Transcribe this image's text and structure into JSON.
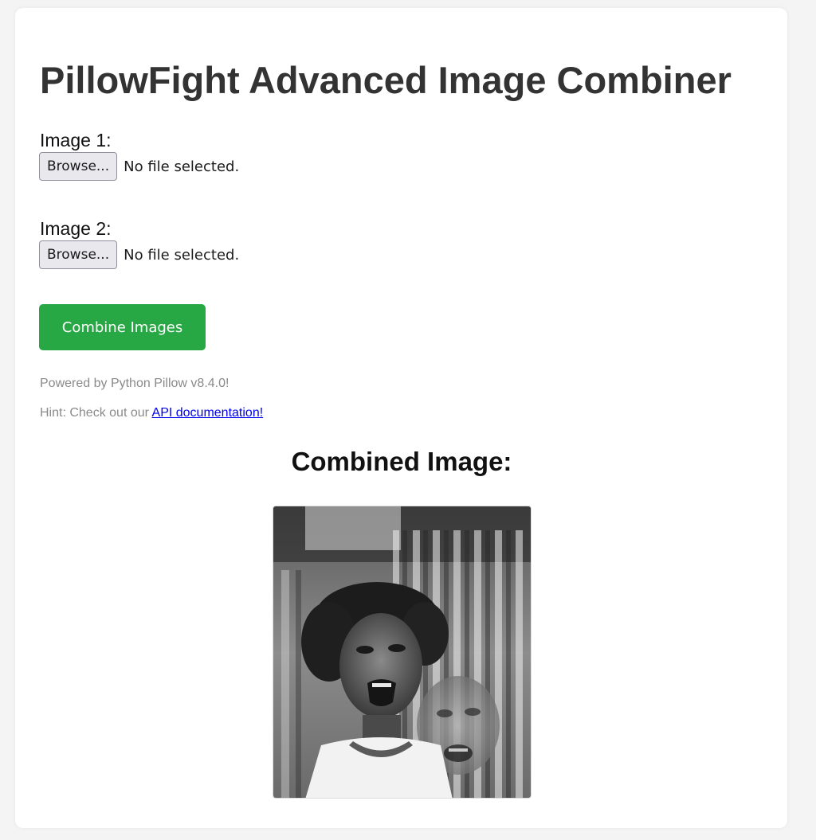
{
  "page": {
    "title": "PillowFight Advanced Image Combiner"
  },
  "form": {
    "image1": {
      "label": "Image 1:",
      "browse_label": "Browse...",
      "status": "No file selected."
    },
    "image2": {
      "label": "Image 2:",
      "browse_label": "Browse...",
      "status": "No file selected."
    },
    "submit_label": "Combine Images",
    "submit_color": "#28a745"
  },
  "footer": {
    "powered_by": "Powered by Python Pillow v8.4.0!",
    "hint_prefix": "Hint: Check out our ",
    "hint_link": "API documentation!"
  },
  "result": {
    "heading": "Combined Image:",
    "image_description": "grayscale blended photo of two screaming faces in front of a barred fence"
  }
}
